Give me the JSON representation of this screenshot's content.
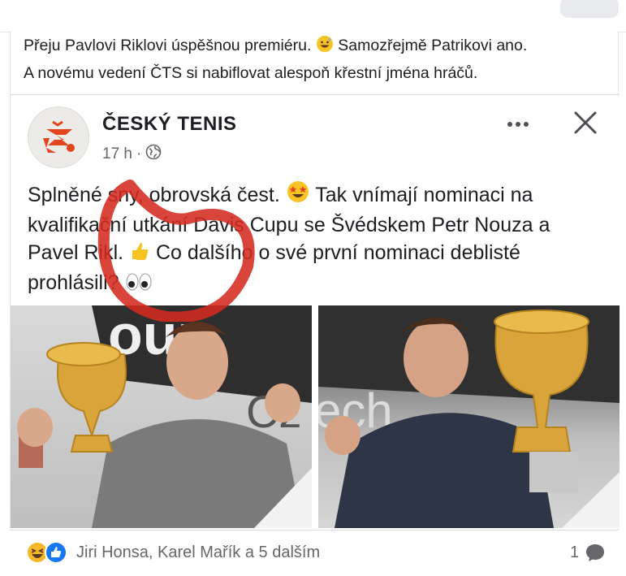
{
  "post": {
    "text_line1_a": "Přeju Pavlovi Riklovi úspěšnou premiéru.",
    "text_line1_b": "Samozřejmě Patrikovi ano.",
    "text_line2": "A novému vedení ČTS si nabiflovat alespoň křestní jména hráčů."
  },
  "shared": {
    "page_name": "ČESKÝ TENIS",
    "time": "17 h",
    "separator": "·",
    "text_a": "Splněné sny, obrovská čest.",
    "text_b": "Tak vnímají nominaci na kvalifikační utkání Davis Cupu se Švédskem Petr Nouza a Pavel Rikl.",
    "text_c": "Co dalšího o své první nominaci deblisté prohlásili?",
    "photo_left_caption": "",
    "photo_right_caption": ""
  },
  "footer": {
    "reactions_text": "Jiri Honsa, Karel Mařík a 5 dalším",
    "comment_count": "1"
  },
  "colors": {
    "brand_orange": "#e2461e",
    "like_blue": "#1877f2",
    "haha_yellow": "#f7b928",
    "annotation_red": "#d42a20"
  },
  "icons": {
    "globe": "globe-icon",
    "more": "more-dots-icon",
    "close": "close-icon",
    "haha": "haha-reaction-icon",
    "like": "like-reaction-icon",
    "comment": "comment-icon"
  }
}
